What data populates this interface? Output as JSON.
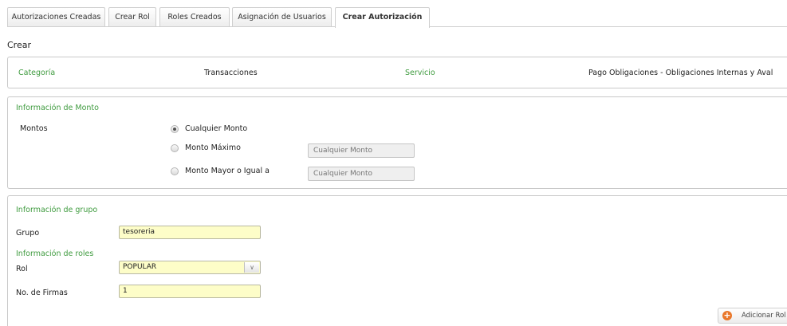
{
  "tabs": [
    {
      "label": "Autorizaciones Creadas",
      "active": false
    },
    {
      "label": "Crear Rol",
      "active": false
    },
    {
      "label": "Roles Creados",
      "active": false
    },
    {
      "label": "Asignación de Usuarios",
      "active": false
    },
    {
      "label": "Crear Autorización",
      "active": true
    }
  ],
  "heading": "Crear",
  "summary": {
    "category_label": "Categoría",
    "category_value": "Transacciones",
    "service_label": "Servicio",
    "service_value": "Pago Obligaciones - Obligaciones Internas y Aval"
  },
  "amount_section": {
    "title": "Información de Monto",
    "label": "Montos",
    "options": [
      {
        "label": "Cualquier Monto",
        "checked": true
      },
      {
        "label": "Monto Máximo",
        "checked": false,
        "placeholder": "Cualquier Monto"
      },
      {
        "label": "Monto Mayor o Igual a",
        "checked": false,
        "placeholder": "Cualquier Monto"
      }
    ]
  },
  "group_section": {
    "title": "Información de grupo",
    "group_label": "Grupo",
    "group_value": "tesoreria",
    "roles_title": "Información de roles",
    "role_label": "Rol",
    "role_value": "POPULAR",
    "signatures_label": "No. de Firmas",
    "signatures_value": "1"
  },
  "add_role_button": "Adicionar Rol"
}
